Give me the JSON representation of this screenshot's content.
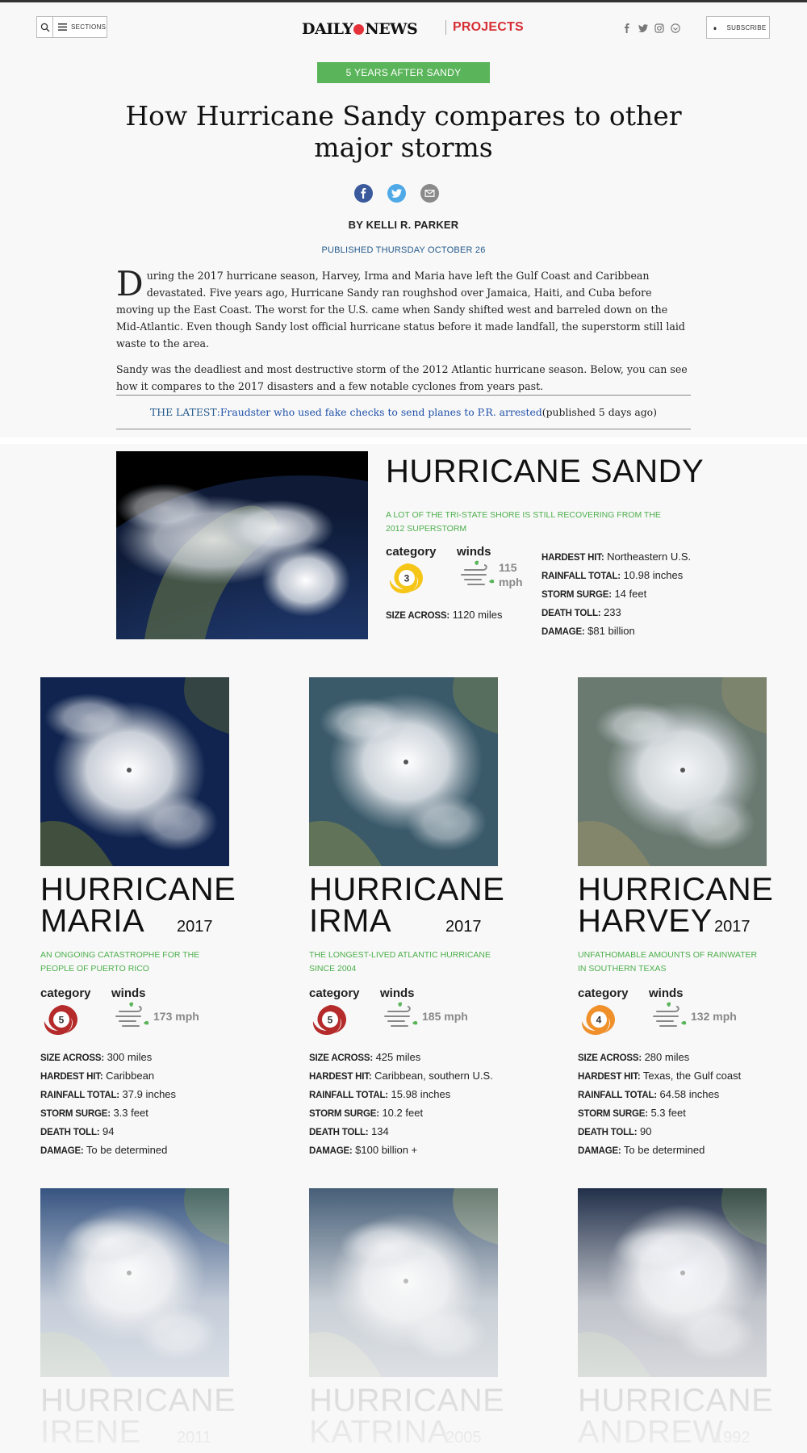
{
  "header": {
    "sections_label": "SECTIONS",
    "logo_left": "DAILY",
    "logo_right": "NEWS",
    "projects_label": "PROJECTS",
    "subscribe_label": "SUBSCRIBE",
    "social_icons": [
      "facebook-icon",
      "twitter-icon",
      "instagram-icon",
      "pinterest-icon"
    ]
  },
  "article": {
    "kicker": "5 YEARS AFTER SANDY",
    "headline": "How Hurricane Sandy compares to other major storms",
    "byline": "BY KELLI R. PARKER",
    "published": "PUBLISHED THURSDAY OCTOBER 26",
    "dropcap": "D",
    "para1": "uring the 2017 hurricane season, Harvey, Irma and Maria have left the Gulf Coast and Caribbean devastated. Five years ago, Hurricane Sandy ran roughshod over Jamaica, Haiti, and Cuba before moving up the East Coast. The worst for the U.S. came when Sandy shifted west and barreled down on the Mid-Atlantic. Even though Sandy lost official hurricane status before it made landfall, the superstorm still laid waste to the area.",
    "para2": "Sandy was the deadliest and most destructive storm of the 2012 Atlantic hurricane season. Below, you can see how it compares to the 2017 disasters and a few notable cyclones from years past.",
    "latest_label": "THE LATEST",
    "latest_colon": ": ",
    "latest_link": "Fraudster who used fake checks to send planes to P.R. arrested",
    "latest_note": " (published 5 days ago)"
  },
  "labels": {
    "category": "category",
    "winds": "winds",
    "size_across": "SIZE ACROSS:",
    "hardest_hit": "HARDEST HIT:",
    "rainfall_total": "RAINFALL TOTAL:",
    "storm_surge": "STORM SURGE:",
    "death_toll": "DEATH TOLL:",
    "damage": "DAMAGE:"
  },
  "sandy": {
    "title": "HURRICANE SANDY",
    "subtitle": "A LOT OF THE TRI-STATE SHORE IS STILL RECOVERING FROM THE 2012 SUPERSTORM",
    "category": "3",
    "category_color": "#f5c518",
    "winds_value": "115",
    "winds_unit": "mph",
    "size_across": " 1120 miles",
    "hardest_hit": " Northeastern U.S.",
    "rainfall_total": " 10.98 inches",
    "storm_surge": " 14 feet",
    "death_toll": " 233",
    "damage": " $81 billion"
  },
  "storms": [
    {
      "title_line1": "HURRICANE",
      "title_line2": "MARIA",
      "year": "2017",
      "subtitle": "AN ONGOING CATASTROPHE FOR THE PEOPLE OF PUERTO RICO",
      "category": "5",
      "category_color": "#b52a2a",
      "winds": "173 mph",
      "size_across": " 300 miles",
      "hardest_hit": " Caribbean",
      "rainfall_total": " 37.9 inches",
      "storm_surge": " 3.3 feet",
      "death_toll": " 94",
      "damage": " To be determined"
    },
    {
      "title_line1": "HURRICANE",
      "title_line2": "IRMA",
      "year": "2017",
      "subtitle": "THE LONGEST-LIVED ATLANTIC HURRICANE SINCE 2004",
      "category": "5",
      "category_color": "#b52a2a",
      "winds": "185 mph",
      "size_across": " 425 miles",
      "hardest_hit": " Caribbean, southern U.S.",
      "rainfall_total": " 15.98 inches",
      "storm_surge": " 10.2 feet",
      "death_toll": " 134",
      "damage": " $100 billion +"
    },
    {
      "title_line1": "HURRICANE",
      "title_line2": "HARVEY",
      "year": "2017",
      "subtitle": "UNFATHOMABLE AMOUNTS OF RAINWATER IN SOUTHERN TEXAS",
      "category": "4",
      "category_color": "#f0902a",
      "winds": "132 mph",
      "size_across": " 280 miles",
      "hardest_hit": " Texas, the Gulf coast",
      "rainfall_total": " 64.58 inches",
      "storm_surge": " 5.3 feet",
      "death_toll": " 90",
      "damage": " To be determined"
    }
  ],
  "faded_storms": [
    {
      "title_line1": "HURRICANE",
      "title_line2": "IRENE",
      "year": "2011"
    },
    {
      "title_line1": "HURRICANE",
      "title_line2": "KATRINA",
      "year": "2005"
    },
    {
      "title_line1": "HURRICANE",
      "title_line2": "ANDREW",
      "year": "1992"
    }
  ]
}
